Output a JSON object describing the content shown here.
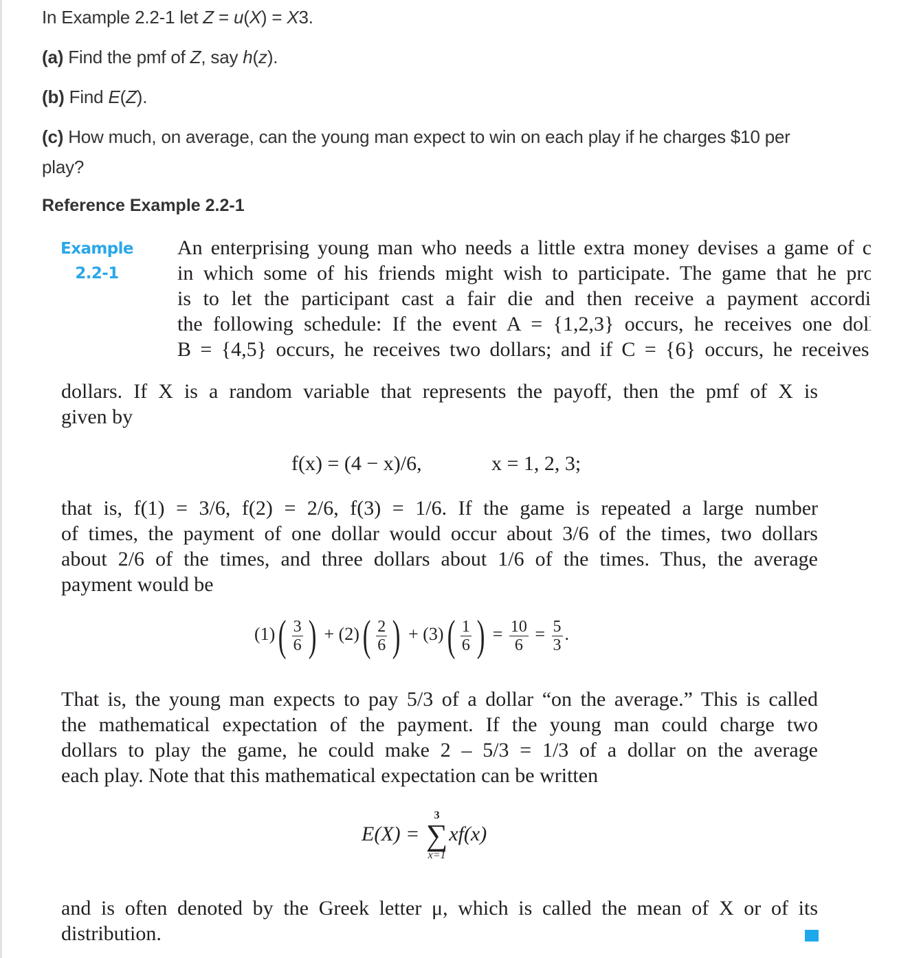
{
  "question": {
    "intro_prefix": "In Example 2.2-1 let ",
    "intro_var_z": "Z",
    "intro_eq1": " = ",
    "intro_u": "u",
    "intro_paren_open": "(",
    "intro_var_x": "X",
    "intro_paren_close": ")",
    "intro_eq2": " = ",
    "intro_x3_var": "X",
    "intro_x3_tail": "3.",
    "part_a_label": "(a)",
    "part_a_text": " Find the pmf of ",
    "part_a_z": "Z",
    "part_a_mid": ", say ",
    "part_a_h": "h",
    "part_a_open": "(",
    "part_a_zlow": "z",
    "part_a_close": ").",
    "part_b_label": "(b)",
    "part_b_text": " Find ",
    "part_b_e": "E",
    "part_b_open": "(",
    "part_b_z": "Z",
    "part_b_close": ").",
    "part_c_label": "(c)",
    "part_c_line1": " How much, on average, can the young man expect to win on each play if he charges $10 per",
    "part_c_line2": "play?"
  },
  "reference": {
    "title": "Reference Example 2.2-1",
    "example_label_line1": "Example",
    "example_label_line2": "2.2-1",
    "clipped_lines": [
      "An enterprising young man who needs a little extra money devises a game of chance",
      "in which some of his friends might wish to participate. The game that he proposes",
      "is to let the participant cast a fair die and then receive a payment according to",
      "the following schedule: If the event A = {1,2,3} occurs, he receives one dollar; if",
      "B = {4,5} occurs, he receives two dollars; and if C = {6} occurs, he receives three"
    ],
    "para1_lines": [
      "dollars. If X is a random variable that represents the payoff, then the pmf of X is",
      "given by"
    ],
    "pmf_lhs": "f(x) = (4 − x)/6,",
    "pmf_rhs": "x = 1, 2, 3;",
    "para2_lines": [
      "that is, f(1) = 3/6, f(2) = 2/6, f(3) = 1/6. If the game is repeated a large number",
      "of times, the payment of one dollar would occur about 3/6 of the times, two dollars",
      "about 2/6 of the times, and three dollars about 1/6 of the times. Thus, the average",
      "payment would be"
    ],
    "avg_eq": {
      "c1": "(1)",
      "n1": "3",
      "d1": "6",
      "plus1": "+",
      "c2": "(2)",
      "n2": "2",
      "d2": "6",
      "plus2": "+",
      "c3": "(3)",
      "n3": "1",
      "d3": "6",
      "eq1": "=",
      "rn1": "10",
      "rd1": "6",
      "eq2": "=",
      "rn2": "5",
      "rd2": "3",
      "tail": "."
    },
    "para3_lines": [
      "That is, the young man expects to pay 5/3 of a dollar “on the average.” This is called",
      "the mathematical expectation of the payment. If the young man could charge two",
      "dollars to play the game, he could make 2 – 5/3 = 1/3 of a dollar on the average",
      "each play. Note that this mathematical expectation can be written"
    ],
    "expect_eq": {
      "lhs": "E(X) = ",
      "upper": "3",
      "sigma": "∑",
      "lower": "x=1",
      "rhs": "xf(x)"
    },
    "para4_lines": [
      "and is often denoted by the Greek letter μ, which is called the mean of X or of its",
      "distribution."
    ],
    "end_mark_color": "#1da8ec",
    "label_color": "#2aa7e8"
  }
}
